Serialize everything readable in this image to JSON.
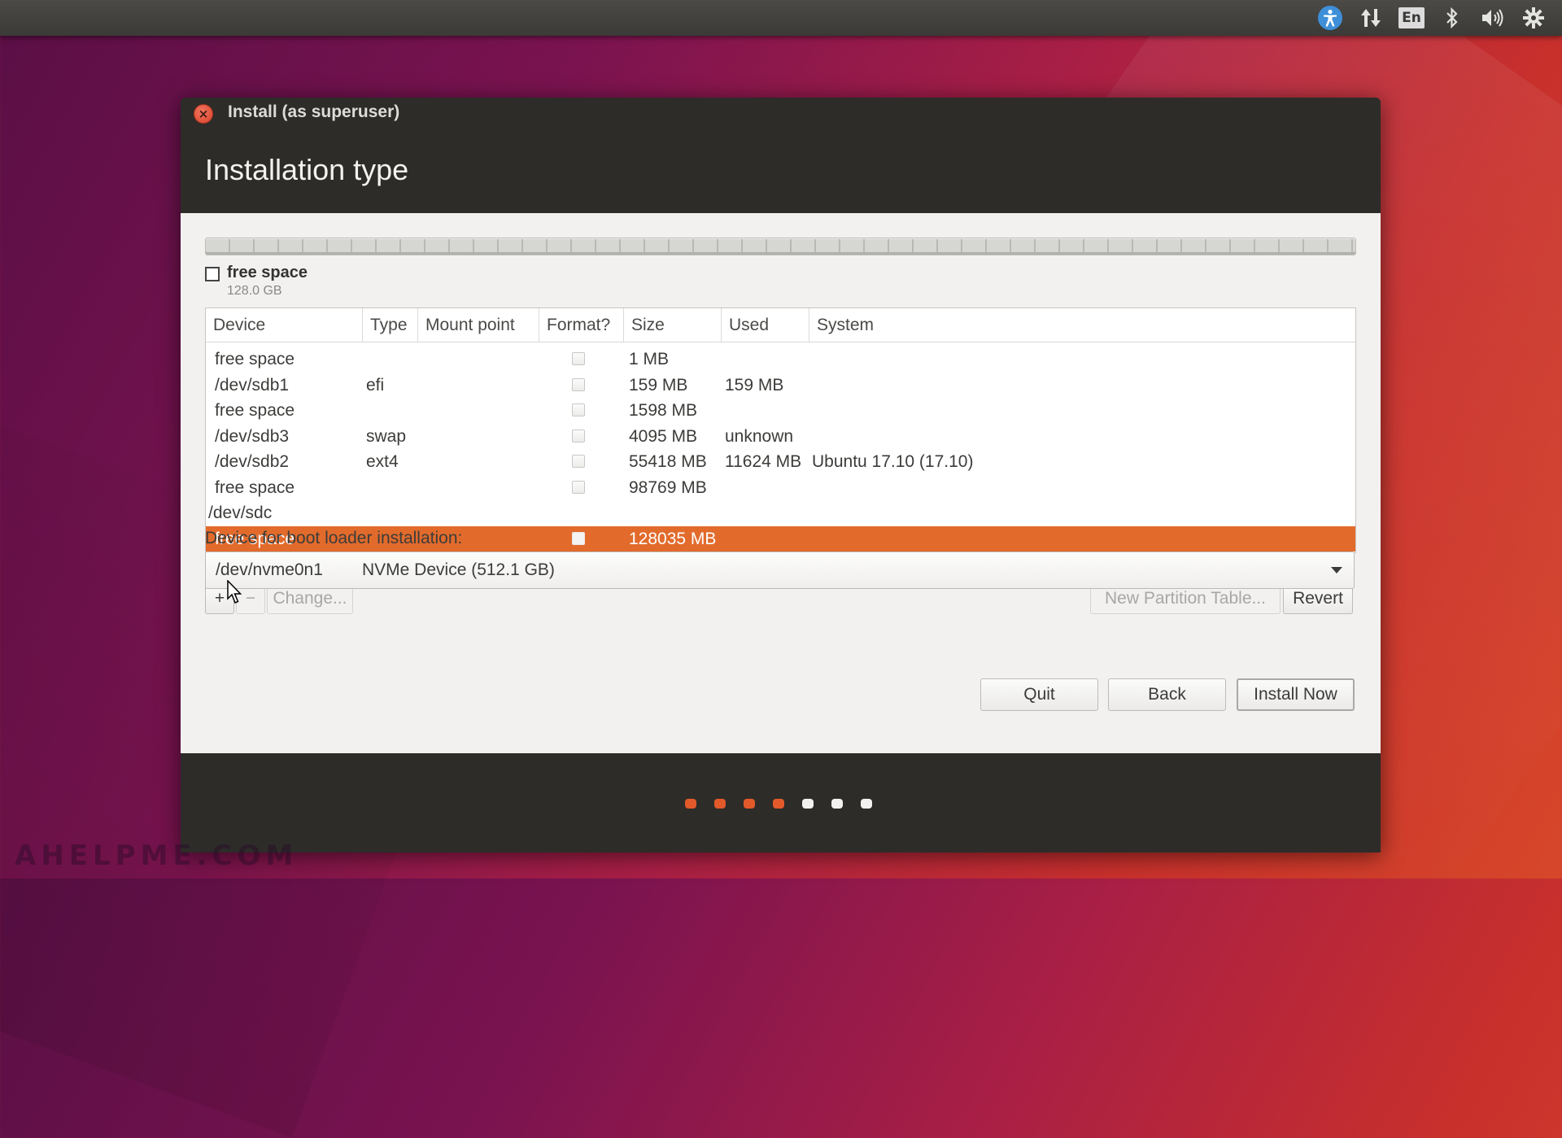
{
  "panel": {
    "lang": "En",
    "icons": [
      "accessibility-icon",
      "network-icon",
      "keyboard-layout-icon",
      "bluetooth-icon",
      "volume-icon",
      "settings-icon"
    ]
  },
  "window": {
    "title": "Install (as superuser)",
    "page_title": "Installation type"
  },
  "legend": {
    "label": "free space",
    "size": "128.0 GB"
  },
  "table": {
    "columns": [
      "Device",
      "Type",
      "Mount point",
      "Format?",
      "Size",
      "Used",
      "System"
    ],
    "rows": [
      {
        "device": "free space",
        "type": "",
        "mount": "",
        "format": false,
        "size": "1 MB",
        "used": "",
        "system": "",
        "indent": true,
        "selected": false
      },
      {
        "device": "/dev/sdb1",
        "type": "efi",
        "mount": "",
        "format": false,
        "size": "159 MB",
        "used": "159 MB",
        "system": "",
        "indent": true,
        "selected": false
      },
      {
        "device": "free space",
        "type": "",
        "mount": "",
        "format": false,
        "size": "1598 MB",
        "used": "",
        "system": "",
        "indent": true,
        "selected": false
      },
      {
        "device": "/dev/sdb3",
        "type": "swap",
        "mount": "",
        "format": false,
        "size": "4095 MB",
        "used": "unknown",
        "system": "",
        "indent": true,
        "selected": false
      },
      {
        "device": "/dev/sdb2",
        "type": "ext4",
        "mount": "",
        "format": false,
        "size": "55418 MB",
        "used": "11624 MB",
        "system": "Ubuntu 17.10 (17.10)",
        "indent": true,
        "selected": false
      },
      {
        "device": "free space",
        "type": "",
        "mount": "",
        "format": false,
        "size": "98769 MB",
        "used": "",
        "system": "",
        "indent": true,
        "selected": false
      },
      {
        "device": "/dev/sdc",
        "type": "",
        "mount": "",
        "format": null,
        "size": "",
        "used": "",
        "system": "",
        "indent": false,
        "selected": false
      },
      {
        "device": "free space",
        "type": "",
        "mount": "",
        "format": false,
        "size": "128035 MB",
        "used": "",
        "system": "",
        "indent": true,
        "selected": true
      }
    ]
  },
  "toolbar": {
    "add_label": "+",
    "remove_label": "−",
    "change_label": "Change...",
    "new_table_label": "New Partition Table...",
    "revert_label": "Revert"
  },
  "boot": {
    "label": "Device for boot loader installation:",
    "device": "/dev/nvme0n1",
    "name": "NVMe Device (512.1 GB)"
  },
  "buttons": {
    "quit": "Quit",
    "back": "Back",
    "install": "Install Now"
  },
  "progress": {
    "total_steps": 7,
    "completed_steps": 4,
    "active_color": "#e2592a",
    "inactive_color": "#f2f1f0"
  },
  "colors": {
    "selection": "#e26b2c",
    "header_bg": "#2d2c29"
  },
  "watermark": "AHELPME.COM"
}
